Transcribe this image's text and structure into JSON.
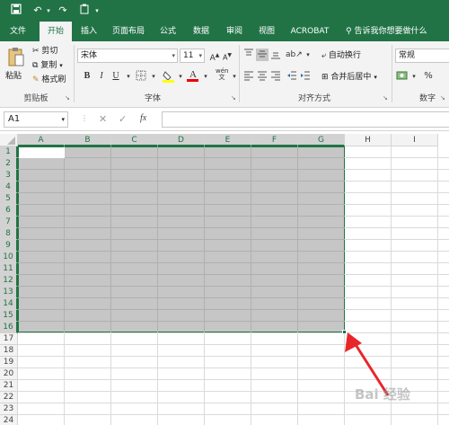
{
  "quick_access": {
    "icons": [
      "save-icon",
      "undo-icon",
      "redo-icon",
      "clipboard-icon",
      "customize-icon"
    ]
  },
  "tabs": [
    {
      "label": "文件",
      "active": false
    },
    {
      "label": "开始",
      "active": true
    },
    {
      "label": "插入",
      "active": false
    },
    {
      "label": "页面布局",
      "active": false
    },
    {
      "label": "公式",
      "active": false
    },
    {
      "label": "数据",
      "active": false
    },
    {
      "label": "审阅",
      "active": false
    },
    {
      "label": "视图",
      "active": false
    },
    {
      "label": "ACROBAT",
      "active": false
    }
  ],
  "tell_me": "告诉我你想要做什么",
  "ribbon": {
    "clipboard": {
      "paste": "粘贴",
      "cut": "剪切",
      "copy": "复制",
      "format_painter": "格式刷",
      "group_label": "剪贴板"
    },
    "font": {
      "font_name": "宋体",
      "font_size": "11",
      "bold": "B",
      "italic": "I",
      "underline": "U",
      "group_label": "字体"
    },
    "alignment": {
      "wrap_text": "自动换行",
      "merge_center": "合并后居中",
      "group_label": "对齐方式"
    },
    "number": {
      "format": "常规",
      "percent": "%",
      "group_label": "数字"
    }
  },
  "formula_bar": {
    "name_box": "A1",
    "fx": "fx",
    "value": ""
  },
  "sheet": {
    "columns": [
      "A",
      "B",
      "C",
      "D",
      "E",
      "F",
      "G",
      "H",
      "I"
    ],
    "rows": [
      "1",
      "2",
      "3",
      "4",
      "5",
      "6",
      "7",
      "8",
      "9",
      "10",
      "11",
      "12",
      "13",
      "14",
      "15",
      "16",
      "17",
      "18",
      "19",
      "20",
      "21",
      "22",
      "23",
      "24"
    ],
    "selected_columns": [
      "A",
      "B",
      "C",
      "D",
      "E",
      "F",
      "G"
    ],
    "selected_rows": 16,
    "selection_range": "A1:G16",
    "accent_color": "#217346"
  },
  "watermark": "Bai 经验"
}
